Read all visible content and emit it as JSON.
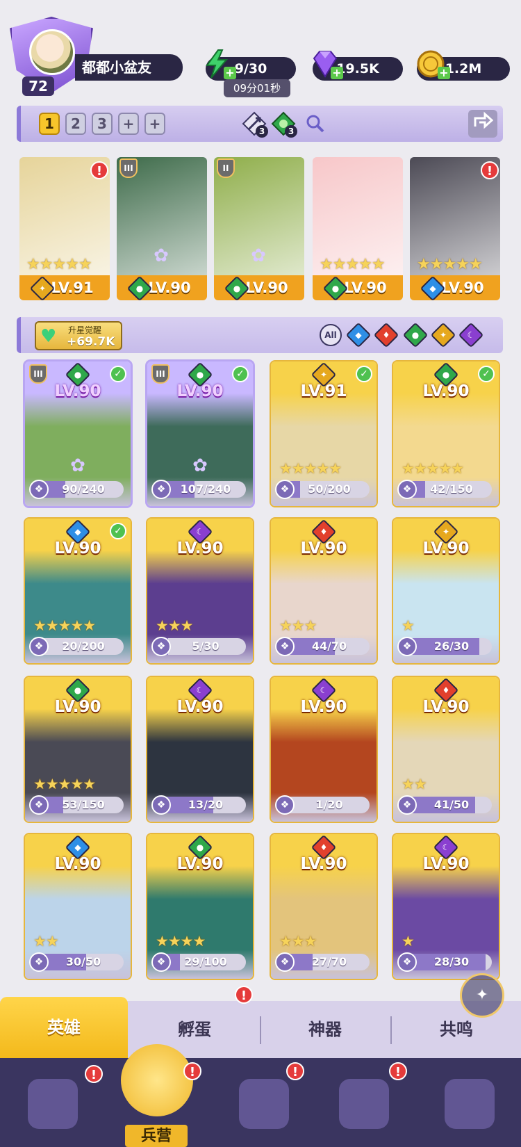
{
  "player": {
    "level": "72",
    "name": "都都小盆友"
  },
  "resources": {
    "energy": "9/30",
    "energy_timer": "09分01秒",
    "gems": "19.5K",
    "gold": "1.2M"
  },
  "team_bar": {
    "slots": [
      "1",
      "2",
      "3",
      "+",
      "+"
    ],
    "active_slot": "1",
    "archer_count": "3",
    "nature_count": "3"
  },
  "team": [
    {
      "level": "LV.91",
      "element": "light",
      "alert": "!",
      "stars": "★★★★★",
      "color": "#e6d49a",
      "rank": "",
      "flower": false
    },
    {
      "level": "LV.90",
      "element": "nature",
      "alert": "",
      "stars": "",
      "color": "#3e6b4a",
      "rank": "III",
      "flower": true
    },
    {
      "level": "LV.90",
      "element": "nature",
      "alert": "",
      "stars": "",
      "color": "#8fae4a",
      "rank": "II",
      "flower": true
    },
    {
      "level": "LV.90",
      "element": "nature",
      "alert": "",
      "stars": "★★★★★",
      "color": "#f7c7c9",
      "rank": "",
      "flower": false
    },
    {
      "level": "LV.90",
      "element": "water",
      "alert": "!",
      "stars": "★★★★★",
      "color": "#4c4a55",
      "rank": "",
      "flower": false
    }
  ],
  "awaken": {
    "label": "升星觉醒",
    "value": "+69.7K"
  },
  "filters": [
    "All",
    "water",
    "fire",
    "nature",
    "light",
    "dark"
  ],
  "filter_all_label": "All",
  "heroes": [
    {
      "level": "LV.90",
      "element": "nature",
      "progress": "90/240",
      "ratio": 0.375,
      "check": true,
      "stars": "",
      "theme": "purple",
      "bg": "#7fae5e",
      "rank": "III",
      "flower": true
    },
    {
      "level": "LV.90",
      "element": "nature",
      "progress": "107/240",
      "ratio": 0.446,
      "check": true,
      "stars": "",
      "theme": "purple",
      "bg": "#3e6b5a",
      "rank": "III",
      "flower": true
    },
    {
      "level": "LV.91",
      "element": "light",
      "progress": "50/200",
      "ratio": 0.25,
      "check": true,
      "stars": "★★★★★",
      "theme": "gold",
      "bg": "#e7d7a6",
      "rank": "",
      "flower": false
    },
    {
      "level": "LV.90",
      "element": "nature",
      "progress": "42/150",
      "ratio": 0.28,
      "check": true,
      "stars": "★★★★★",
      "theme": "gold",
      "bg": "#f3d98f",
      "rank": "",
      "flower": false
    },
    {
      "level": "LV.90",
      "element": "water",
      "progress": "20/200",
      "ratio": 0.1,
      "check": true,
      "stars": "★★★★★",
      "theme": "gold",
      "bg": "#3d8a8a",
      "rank": "",
      "flower": false
    },
    {
      "level": "LV.90",
      "element": "dark",
      "progress": "5/30",
      "ratio": 0.167,
      "check": false,
      "stars": "★★★",
      "theme": "gold",
      "bg": "#5c3e8f",
      "rank": "",
      "flower": false
    },
    {
      "level": "LV.90",
      "element": "fire",
      "progress": "44/70",
      "ratio": 0.629,
      "check": false,
      "stars": "★★★",
      "theme": "gold",
      "bg": "#e8d6cc",
      "rank": "",
      "flower": false
    },
    {
      "level": "LV.90",
      "element": "light",
      "progress": "26/30",
      "ratio": 0.867,
      "check": false,
      "stars": "★",
      "theme": "gold",
      "bg": "#c9e4f0",
      "rank": "",
      "flower": false
    },
    {
      "level": "LV.90",
      "element": "nature",
      "progress": "53/150",
      "ratio": 0.353,
      "check": false,
      "stars": "★★★★★",
      "theme": "gold",
      "bg": "#4a4a55",
      "rank": "",
      "flower": false
    },
    {
      "level": "LV.90",
      "element": "dark",
      "progress": "13/20",
      "ratio": 0.65,
      "check": false,
      "stars": "",
      "theme": "gold",
      "bg": "#2d3440",
      "rank": "",
      "flower": false
    },
    {
      "level": "LV.90",
      "element": "dark",
      "progress": "1/20",
      "ratio": 0.05,
      "check": false,
      "stars": "",
      "theme": "gold",
      "bg": "#b4461f",
      "rank": "",
      "flower": false
    },
    {
      "level": "LV.90",
      "element": "fire",
      "progress": "41/50",
      "ratio": 0.82,
      "check": false,
      "stars": "★★",
      "theme": "gold",
      "bg": "#e4d7b8",
      "rank": "",
      "flower": false
    },
    {
      "level": "LV.90",
      "element": "water",
      "progress": "30/50",
      "ratio": 0.6,
      "check": false,
      "stars": "★★",
      "theme": "gold",
      "bg": "#bcd4ea",
      "rank": "",
      "flower": false
    },
    {
      "level": "LV.90",
      "element": "nature",
      "progress": "29/100",
      "ratio": 0.29,
      "check": false,
      "stars": "★★★★",
      "theme": "gold",
      "bg": "#2f7a6d",
      "rank": "",
      "flower": false
    },
    {
      "level": "LV.90",
      "element": "fire",
      "progress": "27/70",
      "ratio": 0.386,
      "check": false,
      "stars": "★★★",
      "theme": "gold",
      "bg": "#e3c47c",
      "rank": "",
      "flower": false
    },
    {
      "level": "LV.90",
      "element": "dark",
      "progress": "28/30",
      "ratio": 0.933,
      "check": false,
      "stars": "★",
      "theme": "gold",
      "bg": "#6b4aa3",
      "rank": "",
      "flower": false
    }
  ],
  "sub_tabs": [
    {
      "label": "英雄",
      "active": true,
      "alert": false
    },
    {
      "label": "孵蛋",
      "active": false,
      "alert": true
    },
    {
      "label": "神器",
      "active": false,
      "alert": false
    },
    {
      "label": "共鸣",
      "active": false,
      "alert": false
    }
  ],
  "nav": [
    {
      "label": "",
      "icon": "cards-icon",
      "alert": true,
      "active": false
    },
    {
      "label": "兵营",
      "icon": "barracks-icon",
      "alert": true,
      "active": true
    },
    {
      "label": "",
      "icon": "book-icon",
      "alert": true,
      "active": false
    },
    {
      "label": "",
      "icon": "shrine-icon",
      "alert": true,
      "active": false
    },
    {
      "label": "",
      "icon": "mushroom-icon",
      "alert": false,
      "active": false
    }
  ],
  "colors": {
    "water": "#2e8fe6",
    "fire": "#e2402d",
    "nature": "#2fa84a",
    "light": "#e6a81e",
    "dark": "#8a3fd0",
    "accent": "#f3b91b"
  }
}
